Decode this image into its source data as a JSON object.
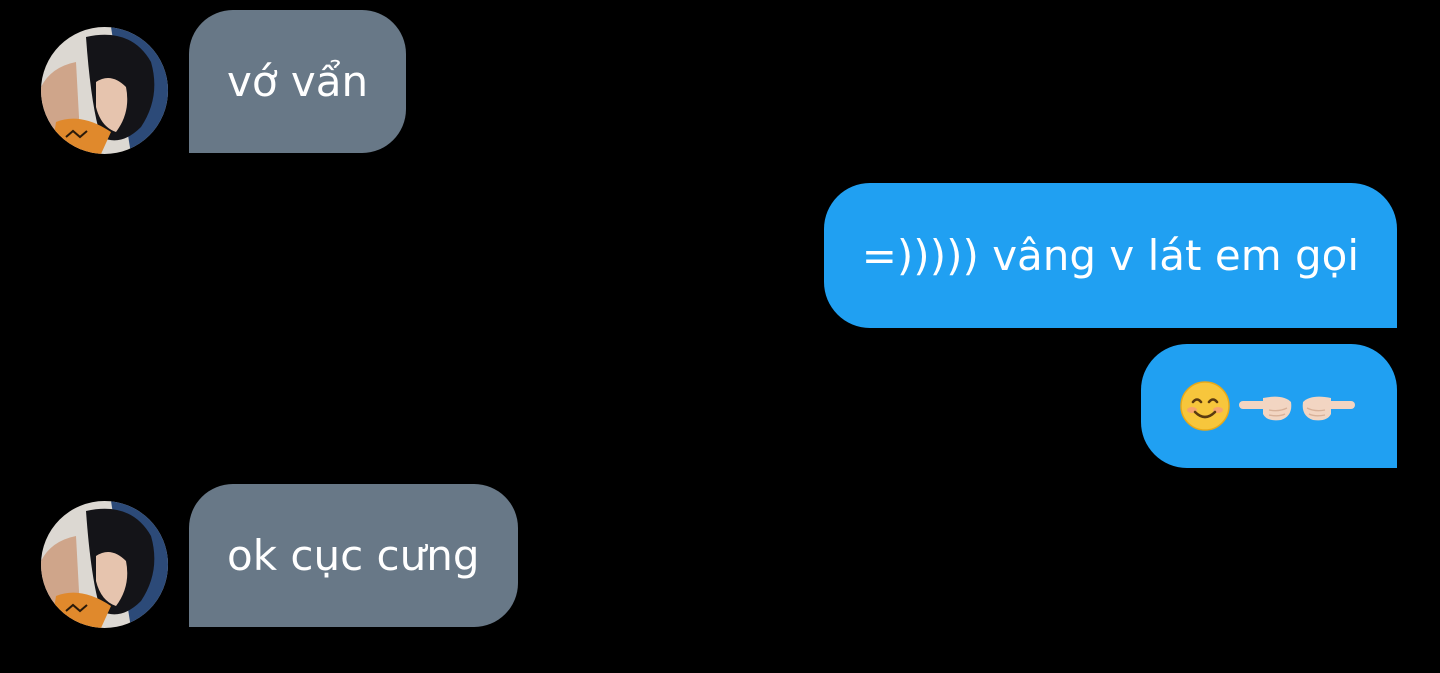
{
  "conversation": {
    "messages": [
      {
        "sender": "contact",
        "text": "vớ vẩn",
        "avatar_icon": "profile-photo-avatar"
      },
      {
        "sender": "me",
        "text": "=))))) vâng v lát em gọi"
      },
      {
        "sender": "me",
        "emojis": [
          "smiling-face-icon",
          "finger-pointing-left-icon",
          "finger-pointing-right-icon"
        ]
      },
      {
        "sender": "contact",
        "text": "ok cục cưng",
        "avatar_icon": "profile-photo-avatar"
      }
    ]
  },
  "colors": {
    "background": "#000000",
    "incoming_bubble": "#687887",
    "outgoing_bubble": "#20a0f2",
    "text": "#ffffff"
  }
}
